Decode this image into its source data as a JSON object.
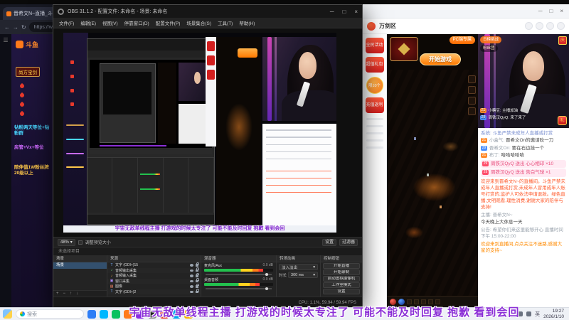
{
  "colors": {
    "accent_orange": "#ff7a1a",
    "banner_purple": "#8b2fd6",
    "douyu_red": "#e8392b",
    "obs_panel": "#232323"
  },
  "banner": {
    "text": "宇宙无敌单线程主播 打游戏的时候太专注了 可能不能及时回复 抱歉 看到会回"
  },
  "icons": {
    "menu": "☰",
    "back": "←",
    "forward": "→",
    "reload": "↻",
    "plus": "+",
    "minus": "−",
    "up": "↑",
    "down": "↓",
    "chevron_down": "▾",
    "check": "✓",
    "close": "×",
    "min": "─",
    "max": "□",
    "tray_chevron": "∧"
  },
  "browser": {
    "tab_title": "晋希文N~直播_斗鱼",
    "url": "https://www.douyu.com",
    "logo": "斗鱼",
    "badges": [
      {
        "text": "尚方宝剑"
      },
      {
        "text": "钻粉两天等位+钻粉群"
      },
      {
        "text": "房管+Vx+等位"
      },
      {
        "text": "陪伴值1W粉丝牌20级以上"
      }
    ]
  },
  "obs": {
    "title": "OBS 31.1.2 - 配置文件: 未命名 - 场景: 未命名",
    "menu": [
      "文件(F)",
      "编辑(E)",
      "视图(V)",
      "停靠窗口(D)",
      "配置文件(P)",
      "场景集合(S)",
      "工具(T)",
      "帮助(H)"
    ],
    "zoom": "48%",
    "fit_label": "调整预览大小",
    "settings_btn": "设置",
    "filters_btn": "过滤器",
    "no_selection": "未选择项目",
    "scenes": {
      "title": "场景",
      "items": [
        "场景"
      ]
    },
    "sources": {
      "title": "来源",
      "items": [
        {
          "glyph": "T",
          "label": "文字 (GDI+)15"
        },
        {
          "glyph": "♪",
          "label": "音频输出采集"
        },
        {
          "glyph": "♪",
          "label": "音频输入采集"
        },
        {
          "glyph": "▣",
          "label": "窗口采集"
        },
        {
          "glyph": "▨",
          "label": "图像"
        },
        {
          "glyph": "T",
          "label": "文字 (GDI+)2"
        }
      ]
    },
    "mixer": {
      "title": "混音器",
      "channels": [
        {
          "name": "麦克风/Aux",
          "db": "0.0 dB"
        },
        {
          "name": "桌面音频",
          "db": "0.0 dB"
        }
      ]
    },
    "transitions": {
      "title": "转场动画",
      "current": "淡入淡出",
      "duration_label": "时长",
      "duration": "300 ms"
    },
    "controls": {
      "title": "控制按钮",
      "buttons": [
        "开始直播",
        "开始录制",
        "启动虚拟摄像机",
        "工作室模式",
        "设置"
      ]
    },
    "status": "CPU: 1.1%, 59.94 / 59.94 FPS"
  },
  "launcher": {
    "server": "万剑区",
    "pc_pill": "PC端专属",
    "start_button": "开始游戏",
    "promos": [
      "全民活动",
      "超值礼包",
      "充值返利"
    ],
    "limit_badge": "限10个"
  },
  "webcam": {
    "rank_pill": "日榜挑战",
    "fan_pill": "粉丝团",
    "badge": "庆",
    "gift_box": "礼",
    "overlays": [
      {
        "level": "21",
        "text": "小糖豆: 主播加油"
      },
      {
        "level": "29",
        "text": "周铁汉QyQ: 来了来了"
      }
    ]
  },
  "chat": {
    "system": "系统: 斗鱼严禁未成年人直播或打赏",
    "messages": [
      {
        "level": "21",
        "user": "小盒气:",
        "text": "晋希文On的邀请砍一刀"
      },
      {
        "level": "29",
        "user": "晋希文On:",
        "text": "要在右边挂一个"
      },
      {
        "level": "21",
        "user": "布丁:",
        "text": "哈哈哈哈哈"
      }
    ],
    "gifts": [
      {
        "level": "29",
        "user": "周铁汉QyQ",
        "text": "送出 心心相印 ×10"
      },
      {
        "level": "29",
        "user": "周铁汉QyQ",
        "text": "送出 告白气球 ×1"
      }
    ],
    "notice": "欢迎来到晋希文N~的直播间。斗鱼严禁未成年人直播或打赏,未成年人冒用成年人账号打赏的,监护人可依法申请退款。绿色直播,文明观看,理性消费,谢谢大家的陪伴与支持!",
    "host_label": "主播: 晋希文N~",
    "host_msg": "今天晚上大休息一天",
    "announce": "公告: 希望你们来这里能够开心 直播时间下午 15:00-22:00",
    "welcome": "欢迎来到直播间,点点关注不迷路,感谢大家的支持~"
  },
  "taskbar": {
    "search": "搜索",
    "lang": "英",
    "time": "19:27",
    "date": "2026/1/10"
  }
}
